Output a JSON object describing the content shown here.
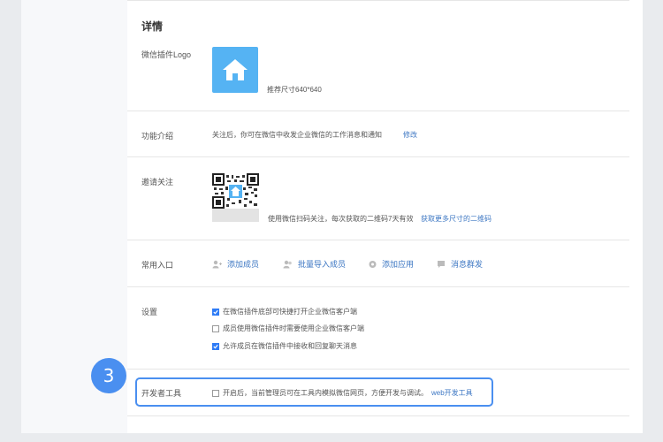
{
  "section": {
    "title": "详情"
  },
  "logo": {
    "label": "微信插件Logo",
    "hint": "推荐尺寸640*640"
  },
  "intro": {
    "label": "功能介绍",
    "text": "关注后，你可在微信中收发企业微信的工作消息和通知",
    "edit": "修改"
  },
  "invite": {
    "label": "邀请关注",
    "text": "使用微信扫码关注，每次获取的二维码7天有效",
    "more": "获取更多尺寸的二维码"
  },
  "entries": {
    "label": "常用入口",
    "items": [
      {
        "label": "添加成员",
        "icon": "add-member-icon"
      },
      {
        "label": "批量导入成员",
        "icon": "batch-import-icon"
      },
      {
        "label": "添加应用",
        "icon": "add-app-icon"
      },
      {
        "label": "消息群发",
        "icon": "message-broadcast-icon"
      }
    ]
  },
  "settings": {
    "label": "设置",
    "options": [
      {
        "label": "在微信插件底部可快捷打开企业微信客户端",
        "checked": true
      },
      {
        "label": "成员使用微信插件时需要使用企业微信客户端",
        "checked": false
      },
      {
        "label": "允许成员在微信插件中接收和回复聊天消息",
        "checked": true
      }
    ]
  },
  "devtools": {
    "label": "开发者工具",
    "text": "开启后，当前管理员可在工具内模拟微信网页，方便开发与调试。",
    "link": "web开发工具",
    "checked": false
  },
  "step": {
    "number": "3"
  },
  "colors": {
    "accent": "#4a8ff0",
    "link": "#3d77c3",
    "logo_bg": "#55b3f3"
  }
}
